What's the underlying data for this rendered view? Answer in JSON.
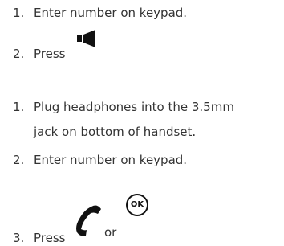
{
  "list1": {
    "step1": {
      "number": "1.",
      "text": "Enter number on keypad."
    },
    "step2": {
      "number": "2.",
      "text": "Press",
      "icon": "speaker-icon"
    }
  },
  "list2": {
    "step1": {
      "number": "1.",
      "line1": "Plug headphones into the 3.5mm",
      "line2": "jack on bottom of handset."
    },
    "step2": {
      "number": "2.",
      "text": "Enter number on keypad."
    },
    "step3": {
      "number": "3.",
      "text": "Press",
      "or_text": "or",
      "icon_1": "handset-icon",
      "icon_2": "ok-button-icon",
      "ok_label": "OK"
    }
  }
}
